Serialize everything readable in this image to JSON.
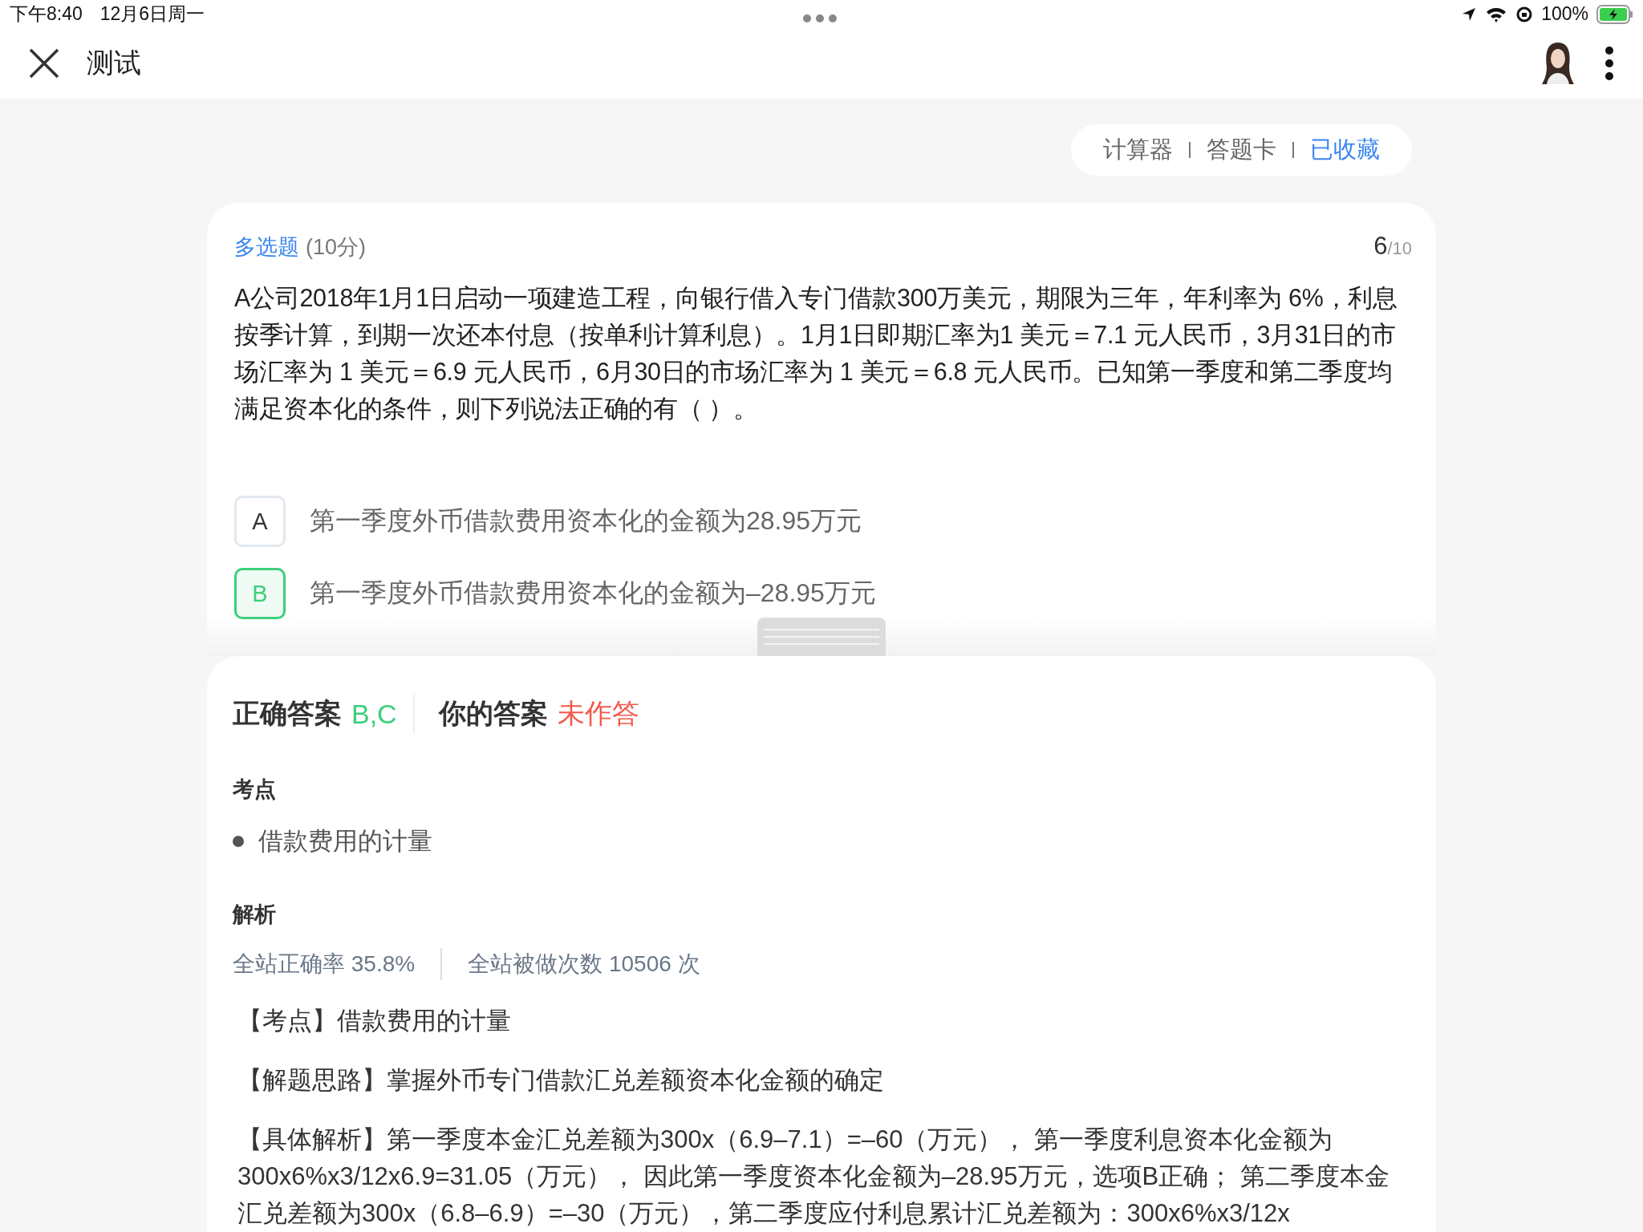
{
  "status_bar": {
    "time": "下午8:40",
    "date": "12月6日周一",
    "battery": "100%"
  },
  "header": {
    "title": "测试"
  },
  "toolbar": {
    "items": [
      {
        "label": "计算器",
        "active": false
      },
      {
        "label": "答题卡",
        "active": false
      },
      {
        "label": "已收藏",
        "active": true
      }
    ]
  },
  "question": {
    "type": "多选题",
    "score": "(10分)",
    "index": "6",
    "total": "/10",
    "text": "A公司2018年1月1日启动一项建造工程，向银行借入专门借款300万美元，期限为三年，年利率为 6%，利息按季计算，到期一次还本付息（按单利计算利息）。1月1日即期汇率为1 美元＝7.1 元人民币，3月31日的市场汇率为 1 美元＝6.9 元人民币，6月30日的市场汇率为 1 美元＝6.8 元人民币。已知第一季度和第二季度均满足资本化的条件，则下列说法正确的有（    ）。",
    "options": [
      {
        "letter": "A",
        "text": "第一季度外币借款费用资本化的金额为28.95万元",
        "correct": false
      },
      {
        "letter": "B",
        "text": "第一季度外币借款费用资本化的金额为–28.95万元",
        "correct": true
      }
    ]
  },
  "answer": {
    "correct_label": "正确答案",
    "correct_value": "B,C",
    "yours_label": "你的答案",
    "yours_value": "未作答",
    "topic_heading": "考点",
    "topics": [
      "借款费用的计量"
    ],
    "analysis_heading": "解析",
    "accuracy": "全站正确率 35.8%",
    "attempts": "全站被做次数 10506 次",
    "paragraphs": [
      "【考点】借款费用的计量",
      "【解题思路】掌握外币专门借款汇兑差额资本化金额的确定",
      "【具体解析】第一季度本金汇兑差额为300x（6.9–7.1）=–60（万元）， 第一季度利息资本化金额为300x6%x3/12x6.9=31.05（万元）， 因此第一季度资本化金额为–28.95万元，选项B正确； 第二季度本金汇兑差额为300x（6.8–6.9）=–30（万元），第二季度应付利息累计汇兑差额为：300x6%x3/12x"
    ]
  }
}
